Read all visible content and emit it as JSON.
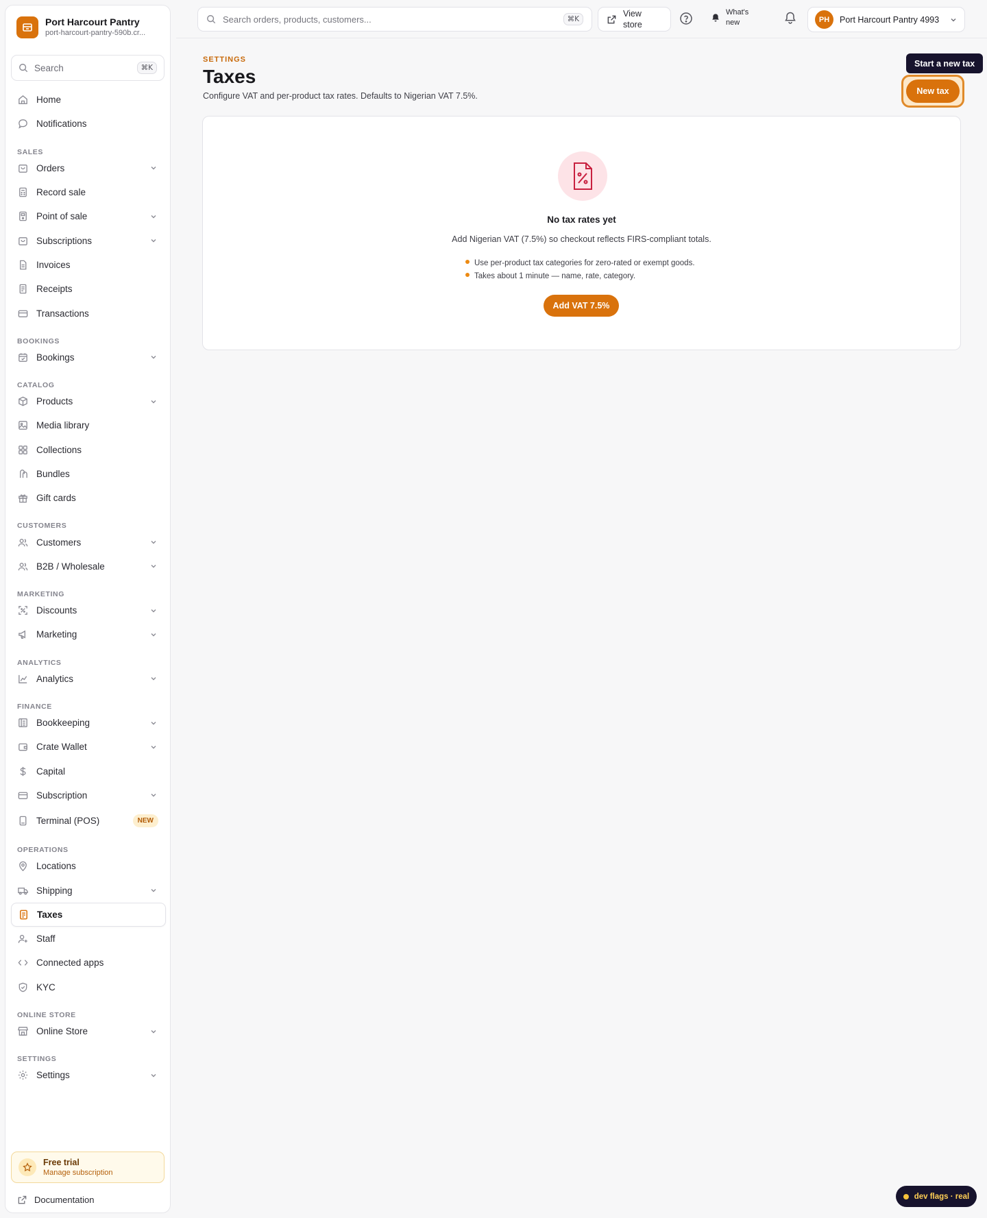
{
  "store": {
    "name": "Port Harcourt Pantry",
    "slug": "port-harcourt-pantry-590b.cr..."
  },
  "sidebar_search": {
    "label": "Search",
    "shortcut": "⌘K"
  },
  "nav": {
    "home": "Home",
    "notifications": "Notifications",
    "sales_section": "SALES",
    "orders": "Orders",
    "record_sale": "Record sale",
    "point_of_sale": "Point of sale",
    "subscriptions": "Subscriptions",
    "invoices": "Invoices",
    "receipts": "Receipts",
    "transactions": "Transactions",
    "bookings_section": "BOOKINGS",
    "bookings": "Bookings",
    "catalog_section": "CATALOG",
    "products": "Products",
    "media_library": "Media library",
    "collections": "Collections",
    "bundles": "Bundles",
    "gift_cards": "Gift cards",
    "customers_section": "CUSTOMERS",
    "customers": "Customers",
    "b2b": "B2B / Wholesale",
    "marketing_section": "MARKETING",
    "discounts": "Discounts",
    "marketing": "Marketing",
    "analytics_section": "ANALYTICS",
    "analytics": "Analytics",
    "finance_section": "FINANCE",
    "bookkeeping": "Bookkeeping",
    "crate_wallet": "Crate Wallet",
    "capital": "Capital",
    "subscription": "Subscription",
    "terminal": "Terminal (POS)",
    "terminal_badge": "NEW",
    "operations_section": "OPERATIONS",
    "locations": "Locations",
    "shipping": "Shipping",
    "taxes": "Taxes",
    "staff": "Staff",
    "connected_apps": "Connected apps",
    "kyc": "KYC",
    "online_store_section": "ONLINE STORE",
    "online_store": "Online Store",
    "settings_section": "SETTINGS",
    "settings": "Settings"
  },
  "trial": {
    "title": "Free trial",
    "subtitle": "Manage subscription"
  },
  "documentation": "Documentation",
  "topbar": {
    "search_placeholder": "Search orders, products, customers...",
    "search_shortcut": "⌘K",
    "view_store": "View store",
    "whats_new": "What's new",
    "account_initials": "PH",
    "account_name": "Port Harcourt Pantry 4993"
  },
  "page": {
    "eyebrow": "SETTINGS",
    "title": "Taxes",
    "subtitle": "Configure VAT and per-product tax rates. Defaults to Nigerian VAT 7.5%.",
    "tooltip": "Start a new tax",
    "new_button": "New tax"
  },
  "empty_state": {
    "title": "No tax rates yet",
    "description": "Add Nigerian VAT (7.5%) so checkout reflects FIRS-compliant totals.",
    "bullets": [
      "Use per-product tax categories for zero-rated or exempt goods.",
      "Takes about 1 minute — name, rate, category."
    ],
    "cta": "Add VAT 7.5%"
  },
  "dev_flags": "dev flags · real",
  "colors": {
    "accent": "#d9720c",
    "tooltip_bg": "#17132d",
    "empty_icon_bg": "#fde3e7",
    "empty_icon_stroke": "#c8203f"
  }
}
